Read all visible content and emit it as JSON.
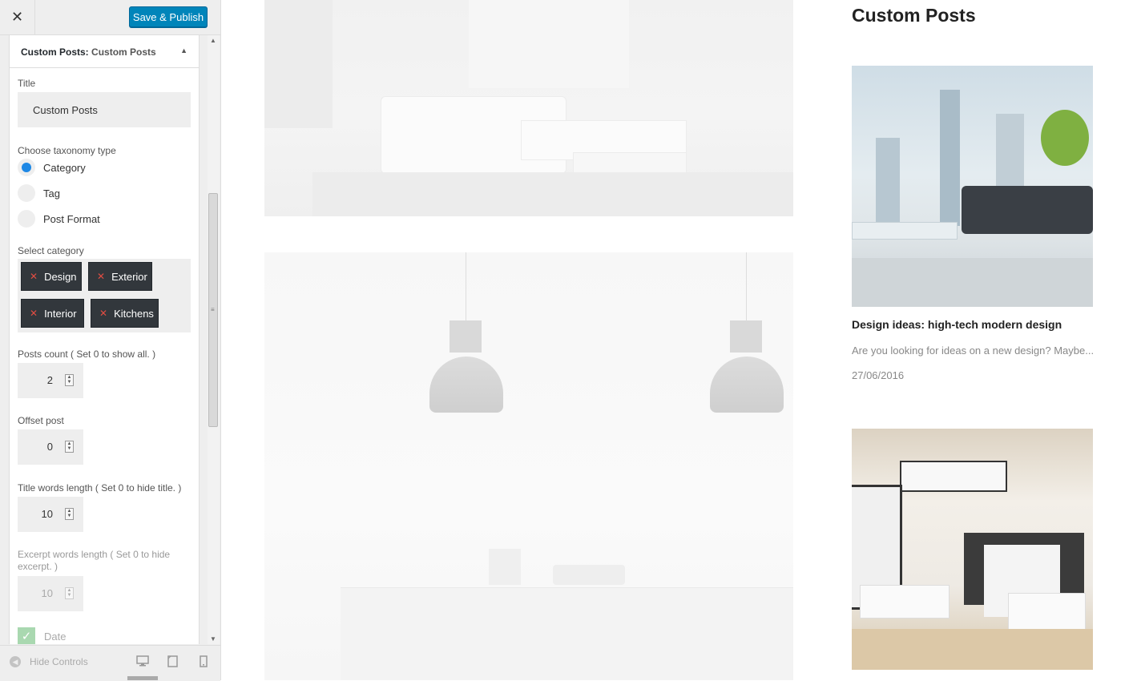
{
  "header": {
    "close_icon": "close-icon",
    "publish_label": "Save & Publish"
  },
  "section": {
    "title_prefix": "Custom Posts:",
    "title_name": "Custom Posts",
    "collapse_icon": "triangle-up-icon"
  },
  "fields": {
    "title_label": "Title",
    "title_value": "Custom Posts",
    "taxonomy_label": "Choose taxonomy type",
    "taxonomy_options": [
      "Category",
      "Tag",
      "Post Format"
    ],
    "taxonomy_selected": "Category",
    "category_label": "Select category",
    "categories": [
      "Design",
      "Exterior",
      "Interior",
      "Kitchens"
    ],
    "remove_icon": "x-icon",
    "posts_count_label": "Posts count ( Set 0 to show all. )",
    "posts_count_value": "2",
    "offset_label": "Offset post",
    "offset_value": "0",
    "title_words_label": "Title words length ( Set 0 to hide title. )",
    "title_words_value": "10",
    "excerpt_words_label": "Excerpt words length ( Set 0 to hide excerpt. )",
    "excerpt_words_value": "10",
    "date_label": "Date",
    "date_checked": true
  },
  "footer": {
    "hide_controls_label": "Hide Controls",
    "devices": [
      "desktop-icon",
      "tablet-icon",
      "mobile-icon"
    ],
    "active_device": "desktop-icon"
  },
  "preview": {
    "widget_title": "Custom Posts",
    "posts": [
      {
        "title": "Design ideas: high-tech modern design",
        "excerpt": "Are you looking for ideas on a new design? Maybe...",
        "date": "27/06/2016"
      }
    ]
  },
  "colors": {
    "accent": "#0085ba",
    "radio_selected": "#1e88e5",
    "chip_bg": "#32373c",
    "chip_remove": "#e14d43"
  }
}
